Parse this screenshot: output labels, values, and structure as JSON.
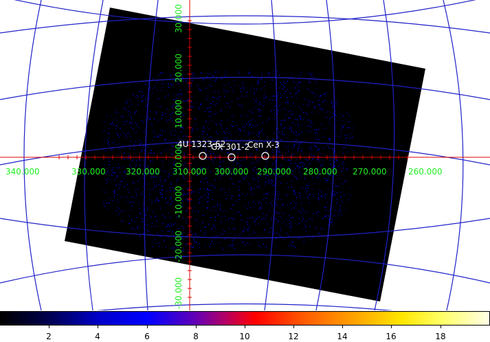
{
  "ra_labels": [
    "340.000",
    "330.000",
    "320.000",
    "310.000",
    "300.000",
    "290.000",
    "280.000",
    "270.000",
    "260.000"
  ],
  "dec_labels": [
    "30.000",
    "20.000",
    "10.000",
    "0.000",
    "-10.000",
    "-20.000",
    "-30.000"
  ],
  "sources": [
    {
      "name": "4U 1323-62"
    },
    {
      "name": "GX 301-2"
    },
    {
      "name": "Cen X-3"
    }
  ],
  "colorbar": {
    "labels": [
      "2",
      "4",
      "6",
      "8",
      "10",
      "12",
      "14",
      "16",
      "18"
    ]
  },
  "colors": {
    "grid": "#2020c8",
    "crosshair": "#dd0000",
    "label": "#22ee22",
    "source_marker": "#ffffff",
    "image_background": "#000000"
  }
}
